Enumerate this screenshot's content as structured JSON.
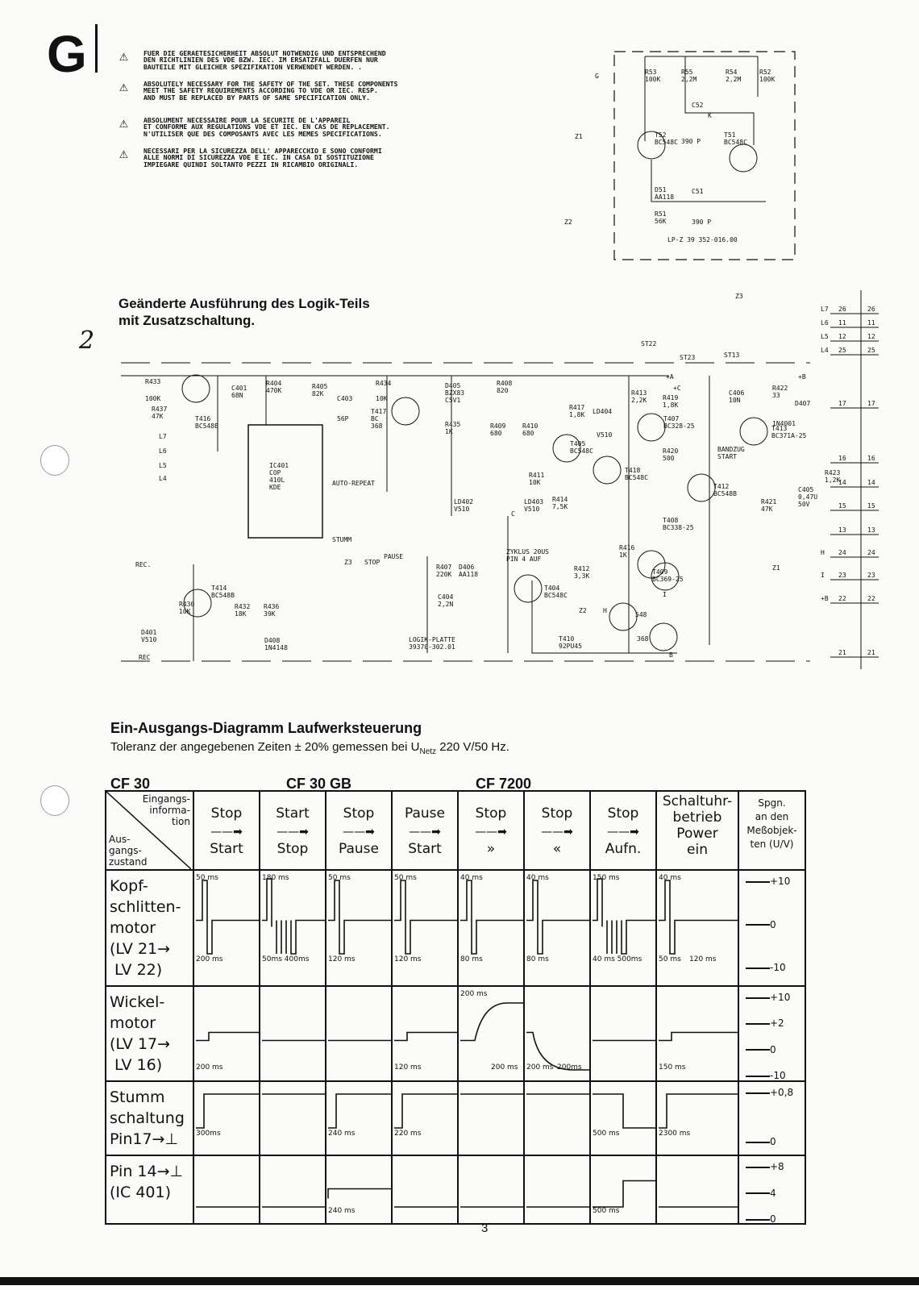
{
  "header": {
    "letter": "G"
  },
  "warnings": [
    "FUER DIE GERAETESICHERHEIT ABSOLUT NOTWENDIG UND ENTSPRECHEND\nDEN RICHTLINIEN DES VDE BZW. IEC. IM ERSATZFALL DUERFEN NUR\nBAUTEILE MIT GLEICHER SPEZIFIKATION VERWENDET WERDEN. .",
    "ABSOLUTELY NECESSARY FOR THE SAFETY OF THE SET. THESE COMPONENTS\nMEET THE SAFETY REQUIREMENTS ACCORDING TO VDE OR IEC. RESP.\nAND MUST BE REPLACED BY PARTS OF SAME SPECIFICATION ONLY.",
    "ABSOLUMENT NECESSAIRE POUR LA SECURITE DE L'APPAREIL\nET CONFORME AUX REGULATIONS VDE ET IEC. EN CAS DE REPLACEMENT.\nN'UTILISER QUE DES COMPOSANTS AVEC LES MEMES SPECIFICATIONS.",
    "NECESSARI PER LA SICUREZZA DELL' APPARECCHIO E SONO CONFORMI\nALLE NORMI DI SICUREZZA VDE E IEC. IN CASA DI SOSTITUZIONE\nIMPIEGARE QUINDI SOLTANTO PEZZI IN RICAMBIO ORIGINALI."
  ],
  "lpz": {
    "labels": [
      "G",
      "Z1",
      "Z2",
      "Z3",
      "R53\n100K",
      "R55\n2,2M",
      "R54\n2,2M",
      "R52\n100K",
      "C52",
      "K",
      "T52\nBC548C",
      "390 P",
      "T51\nBC548C",
      "D51\nAA118",
      "C51",
      "R51\n56K",
      "390 P",
      "LP-Z  39 352-016.00"
    ]
  },
  "logic_title": "Geänderte Ausführung des Logik-Teils\nmit Zusatzschaltung.",
  "margin_note": "2",
  "logic": {
    "labels": [
      "R433",
      "100K",
      "R437\n47K",
      "T416\nBC548B",
      "C401\n68N",
      "R404\n470K",
      "R405\n82K",
      "C403",
      "56P",
      "R434",
      "10K",
      "T417\nBC\n368",
      "D405\nBZX83\nC5V1",
      "R435\n1K",
      "R408\n820",
      "ST22",
      "ST23",
      "ST13",
      "+A",
      "+C",
      "+B",
      "R413\n2,2K",
      "R419\n1,8K",
      "C406\n10N",
      "R422\n33",
      "D407",
      "1N4001",
      "T413\nBC371A-25",
      "R417\n1,8K",
      "LD404",
      "V510",
      "T407\nBC328-25",
      "R409\n680",
      "R410\n680",
      "T405\nBC548C",
      "T418\nBC548C",
      "R420\n500",
      "BANDZUG\nSTART",
      "R411\n10K",
      "R414\n7,5K",
      "LD402\nV510",
      "LD403\nV510",
      "T412\nBC548B",
      "T408\nBC338-25",
      "R421\n47K",
      "R423\n1,2K",
      "C405\n0,47U\n50V",
      "IC401\nCOP\n410L\nKDE",
      "AUTO-REPEAT",
      "STUMM",
      "STOP",
      "PAUSE",
      "REC.",
      "T414\nBC548B",
      "R432\n18K",
      "R436\n39K",
      "D408\n1N4148",
      "D401\nV510",
      "R430\n10K",
      "REC",
      "ZYKLUS 20US\nPIN 4 AUF",
      "R407\n220K",
      "D406\nAA118",
      "C404\n2,2N",
      "T404\nBC548C",
      "R416\n1K",
      "R412\n3,3K",
      "T409\nBC369-25",
      "548",
      "368",
      "T410\n92PU45",
      "LOGIK-PLATTE\n39370-302.01",
      "L7",
      "L6",
      "L5",
      "L4",
      "Z3",
      "Z1",
      "Z2",
      "H",
      "I",
      "B",
      "C",
      "E",
      "G"
    ],
    "connector": [
      {
        "l": "L7",
        "lv": "26"
      },
      {
        "l": "L6",
        "lv": "11"
      },
      {
        "l": "L5",
        "lv": "12"
      },
      {
        "l": "L4",
        "lv": "25"
      },
      {
        "l": "",
        "lv": "17"
      },
      {
        "l": "",
        "lv": "16"
      },
      {
        "l": "",
        "lv": "14"
      },
      {
        "l": "",
        "lv": "15"
      },
      {
        "l": "",
        "lv": "13"
      },
      {
        "l": "H",
        "lv": "24"
      },
      {
        "l": "I",
        "lv": "23"
      },
      {
        "l": "+B",
        "lv": "22"
      },
      {
        "l": "",
        "lv": "21"
      }
    ]
  },
  "diagram": {
    "title": "Ein-Ausgangs-Diagramm Laufwerksteuerung",
    "subtitle_pre": "Toleranz der angegebenen Zeiten ± 20% gemessen bei U",
    "subtitle_sub": "Netz",
    "subtitle_post": " 220 V/50 Hz.",
    "models": [
      "CF 30",
      "CF 30 GB",
      "CF 7200"
    ],
    "corner_top": "Eingangs-\ninforma-\ntion",
    "corner_bottom": "Aus-\ngangs-\nzustand",
    "columns": [
      {
        "from": "Stop",
        "to": "Start"
      },
      {
        "from": "Start",
        "to": "Stop"
      },
      {
        "from": "Stop",
        "to": "Pause"
      },
      {
        "from": "Pause",
        "to": "Start"
      },
      {
        "from": "Stop",
        "to": "»"
      },
      {
        "from": "Stop",
        "to": "«"
      },
      {
        "from": "Stop",
        "to": "Aufn."
      },
      {
        "from": "Schaltuhr-\nbetrieb",
        "to": "Power\nein"
      }
    ],
    "voltage_header": "Spgn.\nan den\nMeßobjek-\nten (U/V)",
    "rows": [
      {
        "label": "Kopf-\nschlitten-\nmotor\n(LV 21→\n LV 22)",
        "volts": [
          "+10",
          "0",
          "-10"
        ],
        "ann": [
          [
            "50 ms",
            "200 ms"
          ],
          [
            "180 ms",
            "50ms 400ms"
          ],
          [
            "50 ms",
            "120 ms"
          ],
          [
            "50 ms",
            "120 ms"
          ],
          [
            "40 ms",
            "80 ms"
          ],
          [
            "40 ms",
            "80 ms"
          ],
          [
            "150 ms",
            "40 ms  500ms"
          ],
          [
            "40 ms",
            "50 ms",
            "120 ms"
          ]
        ]
      },
      {
        "label": "Wickel-\nmotor\n(LV 17→\n LV 16)",
        "volts": [
          "+10",
          "+2",
          "0",
          "-10"
        ],
        "ann": [
          [
            "200 ms"
          ],
          [],
          [],
          [
            "120 ms"
          ],
          [
            "200 ms",
            "200 ms"
          ],
          [
            "200 ms",
            "200ms"
          ],
          [],
          [
            "150 ms"
          ]
        ]
      },
      {
        "label": "Stumm\nschaltung\nPin17→⊥",
        "volts": [
          "+0,8",
          "0"
        ],
        "ann": [
          [
            "300ms"
          ],
          [],
          [
            "240 ms"
          ],
          [
            "220 ms"
          ],
          [],
          [],
          [
            "500 ms"
          ],
          [
            "2300 ms"
          ]
        ]
      },
      {
        "label": "Pin 14→⊥\n(IC 401)",
        "volts": [
          "+8",
          "4",
          "0"
        ],
        "ann": [
          [],
          [],
          [
            "240 ms"
          ],
          [],
          [],
          [],
          [
            "500 ms"
          ],
          []
        ]
      }
    ]
  },
  "page_number": "3"
}
